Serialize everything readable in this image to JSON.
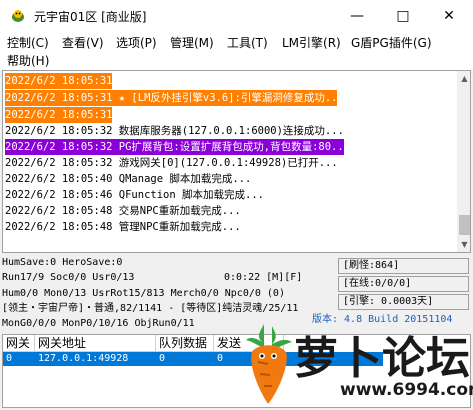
{
  "window": {
    "title": "元宇宙01区 [商业版]",
    "minimize_label": "—",
    "maximize_label": "□",
    "close_label": "✕"
  },
  "menu": {
    "items": [
      "控制(C)",
      "查看(V)",
      "选项(P)",
      "管理(M)",
      "工具(T)",
      "LM引擎(R)",
      "G盾PG插件(G)",
      "帮助(H)"
    ]
  },
  "log": {
    "lines": [
      {
        "text": "2022/6/2 18:05:31",
        "style": "orange"
      },
      {
        "text": "2022/6/2 18:05:31 ★ [LM反外挂引擎v3.6]:引擎漏洞修复成功..",
        "style": "orange"
      },
      {
        "text": "2022/6/2 18:05:31",
        "style": "orange"
      },
      {
        "text": "2022/6/2 18:05:32 数据库服务器(127.0.0.1:6000)连接成功...",
        "style": "normal"
      },
      {
        "text": "2022/6/2 18:05:32 PG扩展背包:设置扩展背包成功,背包数量:80..",
        "style": "purple"
      },
      {
        "text": "2022/6/2 18:05:32 游戏网关[0](127.0.0.1:49928)已打开...",
        "style": "normal"
      },
      {
        "text": "2022/6/2 18:05:40 QManage 脚本加载完成...",
        "style": "normal"
      },
      {
        "text": "2022/6/2 18:05:46 QFunction 脚本加载完成...",
        "style": "normal"
      },
      {
        "text": "2022/6/2 18:05:48 交易NPC重新加载完成...",
        "style": "normal"
      },
      {
        "text": "2022/6/2 18:05:48 管理NPC重新加载完成...",
        "style": "normal"
      }
    ]
  },
  "status": {
    "line1": "HumSave:0 HeroSave:0",
    "line2_left": "Run17/9 Soc0/0 Usr0/13",
    "line2_mid": "0:0:22 [M][F]",
    "line3": "Hum0/0 Mon0/13 UsrRot15/813 Merch0/0 Npc0/0 (0)",
    "line4": "[领主・宇宙尸帝]・普通,82/1141 - [等待区]纯洁灵魂/25/11",
    "line5_left": "MonG0/0/0 MonP0/10/16 ObjRun0/11",
    "build_text": "版本: 4.8 Build 20151104",
    "refresh": "[刷怪:864]",
    "online": "[在线:0/0/0]",
    "engine": "[引擎: 0.0003天]"
  },
  "table": {
    "headers": [
      "网关",
      "网关地址",
      "队列数据",
      "发送"
    ],
    "rows": [
      [
        "0",
        "127.0.0.1:49928",
        "0",
        "0"
      ]
    ]
  },
  "watermark": {
    "site_name": "萝卜论坛",
    "url": "www.6994.com"
  },
  "colors": {
    "orange_highlight": "#ff7f00",
    "purple_highlight": "#8b00d9",
    "selection_blue": "#0078d7"
  }
}
